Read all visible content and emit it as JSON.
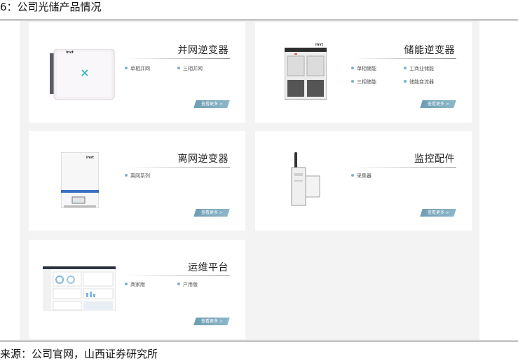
{
  "figure_title": "6：公司光储产品情况",
  "source": "来源：公司官网，山西证券研究所",
  "more_label": "查看更多 >",
  "brand": "invt",
  "cards": [
    {
      "title": "并网逆变器",
      "features": [
        "单相并网",
        "三相并网"
      ],
      "image": "grid-inverter-icon"
    },
    {
      "title": "储能逆变器",
      "features": [
        "单相储能",
        "工商业储能",
        "三相储能",
        "储能变流器"
      ],
      "image": "storage-cabinet-icon"
    },
    {
      "title": "离网逆变器",
      "features": [
        "离网系列"
      ],
      "image": "offgrid-inverter-icon"
    },
    {
      "title": "监控配件",
      "features": [
        "采集器"
      ],
      "image": "datalogger-icon"
    },
    {
      "title": "运维平台",
      "features": [
        "商家版",
        "户用版"
      ],
      "image": "dashboard-screenshot-icon"
    }
  ],
  "colors": {
    "accent": "#7eb0c9",
    "button": "#7aa8be",
    "panel_bg": "#f3f3f3"
  }
}
